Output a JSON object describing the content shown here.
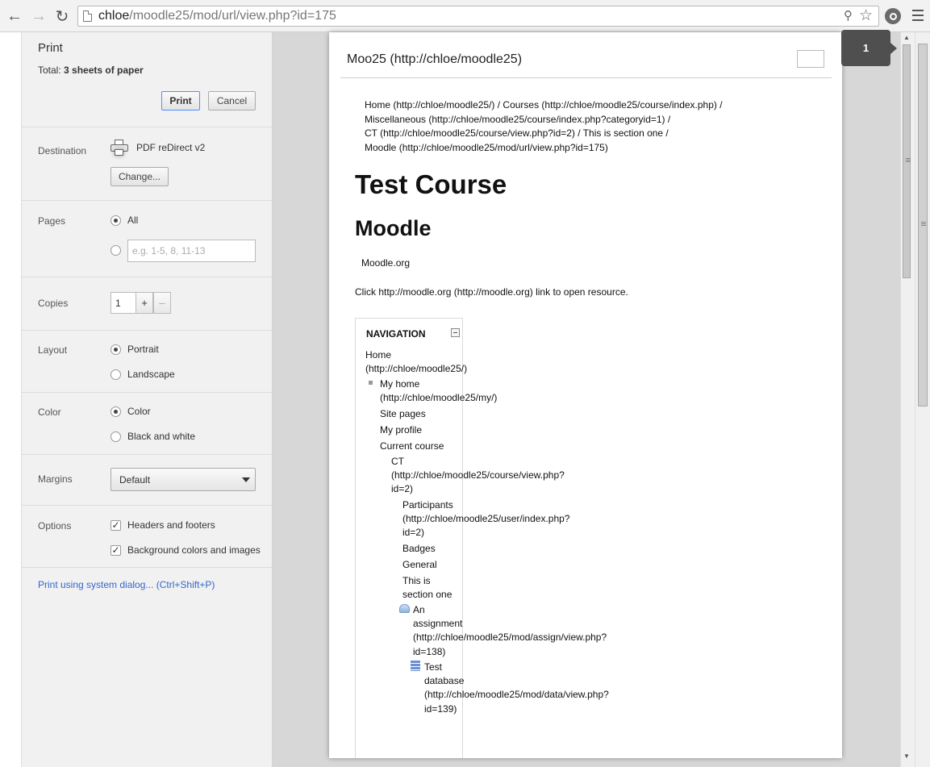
{
  "browser": {
    "url_host": "chloe",
    "url_path": "/moodle25/mod/url/view.php?id=175",
    "icons": [
      "back-arrow-icon",
      "forward-arrow-icon",
      "reload-icon",
      "page-icon",
      "zoom-icon",
      "star-icon",
      "extension-icon",
      "menu-icon"
    ]
  },
  "print": {
    "title": "Print",
    "total_label": "Total: ",
    "total_value": "3 sheets of paper",
    "print_button": "Print",
    "cancel_button": "Cancel",
    "destination": {
      "label": "Destination",
      "printer": "PDF reDirect v2",
      "change_button": "Change..."
    },
    "pages": {
      "label": "Pages",
      "all": "All",
      "range_placeholder": "e.g. 1-5, 8, 11-13"
    },
    "copies": {
      "label": "Copies",
      "value": "1",
      "plus": "+",
      "minus": "–"
    },
    "layout": {
      "label": "Layout",
      "portrait": "Portrait",
      "landscape": "Landscape"
    },
    "color": {
      "label": "Color",
      "color": "Color",
      "bw": "Black and white"
    },
    "margins": {
      "label": "Margins",
      "value": "Default"
    },
    "options": {
      "label": "Options",
      "headers_footers": "Headers and footers",
      "background": "Background colors and images"
    },
    "system_dialog": "Print using system dialog... (Ctrl+Shift+P)"
  },
  "preview": {
    "page_count": "1",
    "header": "Moo25 (http://chloe/moodle25)",
    "crumbs": [
      "Home (http://chloe/moodle25/)  /  Courses (http://chloe/moodle25/course/index.php)  /",
      "Miscellaneous (http://chloe/moodle25/course/index.php?categoryid=1)  /",
      "CT (http://chloe/moodle25/course/view.php?id=2)  /  This is section one  /",
      "Moodle (http://chloe/moodle25/mod/url/view.php?id=175)"
    ],
    "h1": "Test Course",
    "h2": "Moodle",
    "link_text": "Moodle.org",
    "click_text": "Click http://moodle.org (http://moodle.org) link to open resource.",
    "nav": {
      "title": "NAVIGATION",
      "home_1": "Home",
      "home_2": "(http://chloe/moodle25/)",
      "myhome_1": "My home",
      "myhome_2": "(http://chloe/moodle25/my/)",
      "site_pages": "Site pages",
      "my_profile": "My profile",
      "current_course": "Current course",
      "ct_1": "CT",
      "ct_2": "(http://chloe/moodle25/course/view.php?",
      "ct_3": "id=2)",
      "part_1": "Participants",
      "part_2": "(http://chloe/moodle25/user/index.php?",
      "part_3": "id=2)",
      "badges": "Badges",
      "general": "General",
      "sec_1": "This is",
      "sec_2": "section one",
      "asg_1": "An",
      "asg_2": "assignment",
      "asg_3": "(http://chloe/moodle25/mod/assign/view.php?",
      "asg_4": "id=138)",
      "db_1": "Test",
      "db_2": "database",
      "db_3": "(http://chloe/moodle25/mod/data/view.php?",
      "db_4": "id=139)"
    }
  }
}
